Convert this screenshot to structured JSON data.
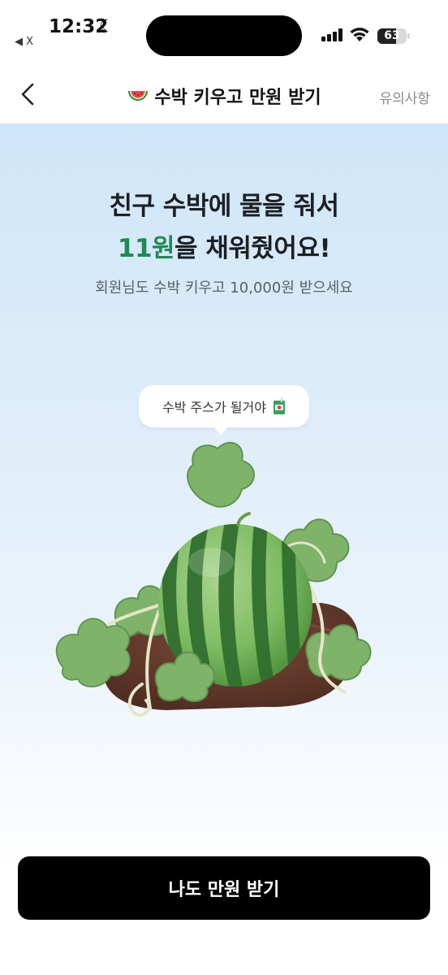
{
  "status_bar": {
    "time": "12:32",
    "back_app_label": "◀ X",
    "battery_level": "63",
    "icons": [
      "moon-icon",
      "signal-icon",
      "wifi-icon",
      "battery-icon"
    ]
  },
  "nav": {
    "title_emoji": "🍉",
    "title": "수박 키우고 만원 받기",
    "notice_link": "유의사항",
    "back_icon": "chevron-left-icon"
  },
  "hero": {
    "headline_line1": "친구 수박에 물을 줘서",
    "headline_amount": "11원",
    "headline_line2_rest": "을 채워줬어요!",
    "subline": "회원님도 수박 키우고 10,000원 받으세요",
    "bubble_text": "수박 주스가 될거야",
    "bubble_icon": "juice-box-icon",
    "accent_color": "#1f8a55"
  },
  "cta": {
    "label": "나도 만원 받기"
  }
}
